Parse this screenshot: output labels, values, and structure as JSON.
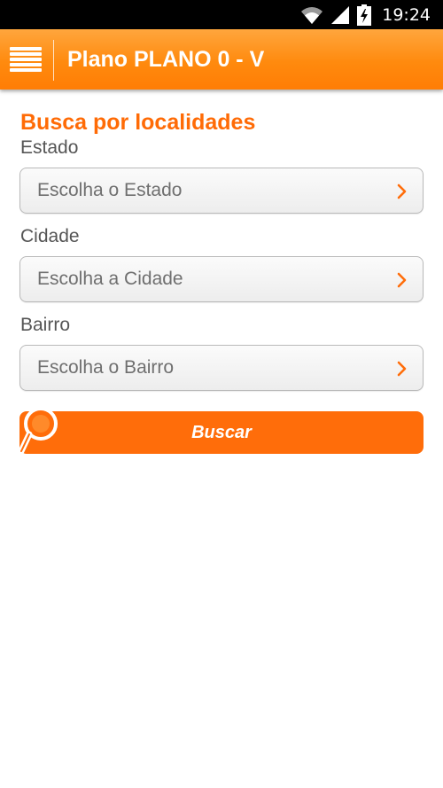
{
  "status_bar": {
    "time": "19:24",
    "icons": [
      "wifi-icon",
      "signal-icon",
      "battery-charging-icon"
    ]
  },
  "action_bar": {
    "menu_icon": "hamburger-menu-icon",
    "title": "Plano PLANO 0 - V"
  },
  "content": {
    "section_title": "Busca por localidades",
    "fields": [
      {
        "label": "Estado",
        "placeholder": "Escolha o Estado"
      },
      {
        "label": "Cidade",
        "placeholder": "Escolha a Cidade"
      },
      {
        "label": "Bairro",
        "placeholder": "Escolha o Bairro"
      }
    ],
    "search_button": {
      "label": "Buscar",
      "icon": "magnifier-icon"
    }
  },
  "colors": {
    "accent": "#ff6d0a",
    "action_bar": "#ff8a0e",
    "title_orange": "#ff6b06"
  }
}
